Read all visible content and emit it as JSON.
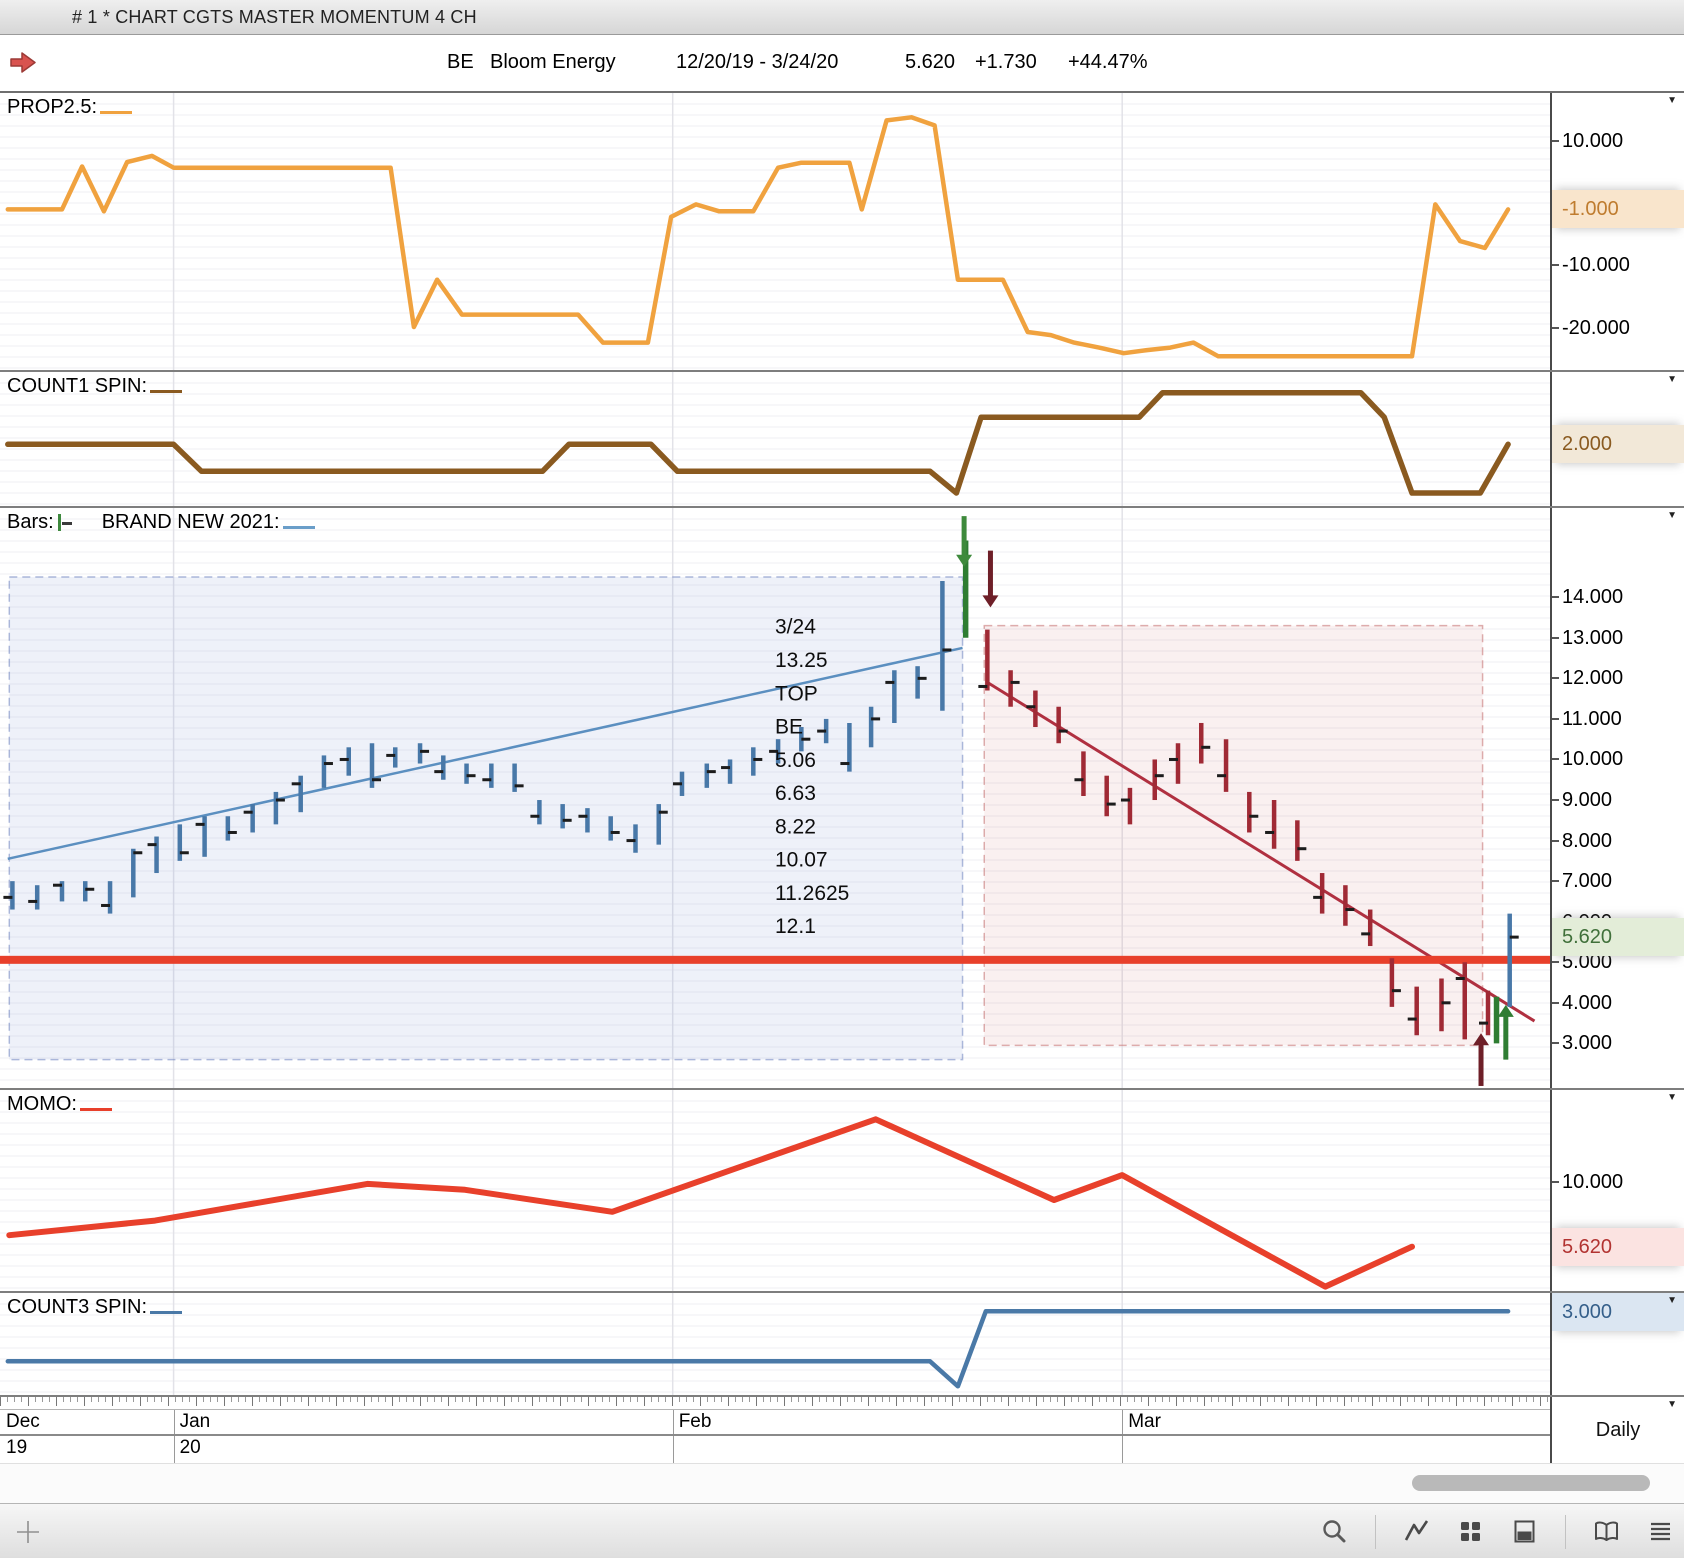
{
  "window": {
    "title": "# 1 * CHART CGTS MASTER MOMENTUM 4 CH"
  },
  "header": {
    "symbol": "BE",
    "name": "Bloom Energy",
    "range": "12/20/19 - 3/24/20",
    "last": "5.620",
    "change": "+1.730",
    "pct": "+44.47%",
    "arrow_icon": "red-right-arrow-icon",
    "arrow_color": "#d9534f"
  },
  "xaxis": {
    "months": [
      {
        "label": "Dec",
        "year": "19",
        "frac": 0.0
      },
      {
        "label": "Jan",
        "year": "20",
        "frac": 0.112
      },
      {
        "label": "Feb",
        "year": "",
        "frac": 0.434
      },
      {
        "label": "Mar",
        "year": "",
        "frac": 0.724
      }
    ],
    "period": "Daily"
  },
  "toolbar": {
    "left_icon": "crosshair-plus-icon",
    "right_icons": [
      "magnifier-icon",
      "line-chart-icon",
      "grid-view-icon",
      "split-view-icon",
      "book-icon",
      "menu-lines-icon"
    ]
  },
  "chart_data": [
    {
      "id": "prop25",
      "type": "line",
      "title": "PROP2.5:",
      "accent": "#f0a23f",
      "ylim": [
        -26.8,
        17.7
      ],
      "axis_labels": [
        {
          "v": 10,
          "label": "10.000"
        },
        {
          "v": -10,
          "label": "-10.000"
        },
        {
          "v": -20,
          "label": "-20.000"
        }
      ],
      "badge": {
        "v": -1,
        "label": "-1.000",
        "bg": "#f9e5cc",
        "fg": "#bf7c2f"
      },
      "series": [
        {
          "name": "PROP2.5",
          "color": "#f0a23f",
          "width": 4.5,
          "points": [
            [
              0.005,
              -1.0
            ],
            [
              0.04,
              -1.0
            ],
            [
              0.053,
              5.9
            ],
            [
              0.067,
              -1.3
            ],
            [
              0.082,
              6.6
            ],
            [
              0.098,
              7.6
            ],
            [
              0.112,
              5.7
            ],
            [
              0.252,
              5.7
            ],
            [
              0.267,
              -19.9
            ],
            [
              0.282,
              -12.3
            ],
            [
              0.298,
              -17.9
            ],
            [
              0.373,
              -17.9
            ],
            [
              0.389,
              -22.4
            ],
            [
              0.418,
              -22.4
            ],
            [
              0.433,
              -2.2
            ],
            [
              0.449,
              -0.2
            ],
            [
              0.464,
              -1.3
            ],
            [
              0.486,
              -1.3
            ],
            [
              0.502,
              5.7
            ],
            [
              0.517,
              6.5
            ],
            [
              0.548,
              6.5
            ],
            [
              0.556,
              -1.0
            ],
            [
              0.572,
              13.3
            ],
            [
              0.588,
              13.8
            ],
            [
              0.603,
              12.5
            ],
            [
              0.618,
              -12.3
            ],
            [
              0.647,
              -12.3
            ],
            [
              0.663,
              -20.7
            ],
            [
              0.678,
              -21.2
            ],
            [
              0.693,
              -22.4
            ],
            [
              0.709,
              -23.2
            ],
            [
              0.725,
              -24.1
            ],
            [
              0.74,
              -23.6
            ],
            [
              0.755,
              -23.2
            ],
            [
              0.77,
              -22.4
            ],
            [
              0.786,
              -24.6
            ],
            [
              0.911,
              -24.6
            ],
            [
              0.926,
              -0.2
            ],
            [
              0.942,
              -6.1
            ],
            [
              0.958,
              -7.2
            ],
            [
              0.973,
              -1.0
            ]
          ]
        }
      ]
    },
    {
      "id": "count1",
      "type": "line",
      "title": "COUNT1 SPIN:",
      "accent": "#8a5a20",
      "ylim": [
        -0.28,
        4.67
      ],
      "axis_labels": [],
      "badge": {
        "v": 2,
        "label": "2.000",
        "bg": "#f2e8d8",
        "fg": "#8a5a20"
      },
      "series": [
        {
          "name": "COUNT1 SPIN",
          "color": "#8a5a20",
          "width": 5.5,
          "points": [
            [
              0.005,
              2
            ],
            [
              0.112,
              2
            ],
            [
              0.13,
              1
            ],
            [
              0.35,
              1
            ],
            [
              0.367,
              2
            ],
            [
              0.42,
              2
            ],
            [
              0.437,
              1
            ],
            [
              0.6,
              1
            ],
            [
              0.617,
              0.2
            ],
            [
              0.633,
              3
            ],
            [
              0.735,
              3
            ],
            [
              0.75,
              3.9
            ],
            [
              0.878,
              3.9
            ],
            [
              0.893,
              3
            ],
            [
              0.911,
              0.2
            ],
            [
              0.955,
              0.2
            ],
            [
              0.973,
              2.0
            ]
          ]
        }
      ]
    },
    {
      "id": "bars",
      "type": "ohlc-bars",
      "title": "Bars:",
      "title2": "BRAND NEW 2021:",
      "accent": "#6a9ec9",
      "bar_glyph_color": "#3f8a3f",
      "ylim": [
        1.9,
        16.2
      ],
      "axis_labels": [
        {
          "v": 14,
          "label": "14.000"
        },
        {
          "v": 13,
          "label": "13.000"
        },
        {
          "v": 12,
          "label": "12.000"
        },
        {
          "v": 11,
          "label": "11.000"
        },
        {
          "v": 10,
          "label": "10.000"
        },
        {
          "v": 9,
          "label": "9.000"
        },
        {
          "v": 8,
          "label": "8.000"
        },
        {
          "v": 7,
          "label": "7.000"
        },
        {
          "v": 6,
          "label": "6.000"
        },
        {
          "v": 5,
          "label": "5.000"
        },
        {
          "v": 4,
          "label": "4.000"
        },
        {
          "v": 3,
          "label": "3.000"
        }
      ],
      "badge": {
        "v": 5.62,
        "label": "5.620",
        "bg": "#e3edd8",
        "fg": "#40703a"
      },
      "boxes": [
        {
          "x0": 0.006,
          "x1": 0.621,
          "v0": 2.6,
          "v1": 14.5,
          "fill": "rgba(125,145,205,0.13)",
          "stroke": "rgba(110,130,190,0.55)"
        },
        {
          "x0": 0.635,
          "x1": 0.9565,
          "v0": 2.95,
          "v1": 13.3,
          "fill": "rgba(205,110,110,0.10)",
          "stroke": "rgba(205,130,130,0.65)"
        }
      ],
      "trendlines": [
        {
          "name": "uptrend",
          "color": "#5b8fc0",
          "width": 2.5,
          "points": [
            [
              0.005,
              7.55
            ],
            [
              0.621,
              12.75
            ]
          ]
        },
        {
          "name": "downtrend",
          "color": "#b03040",
          "width": 3,
          "points": [
            [
              0.637,
              11.9
            ],
            [
              0.99,
              3.55
            ]
          ]
        }
      ],
      "hline": {
        "v": 5.06,
        "color": "#e8402b",
        "width": 8
      },
      "bars_up": {
        "color": "#4878a8",
        "items": [
          [
            0.008,
            6.3,
            7.0,
            6.6,
            "L"
          ],
          [
            0.024,
            6.3,
            6.9,
            6.5,
            "L"
          ],
          [
            0.04,
            6.5,
            7.0,
            6.9,
            "L"
          ],
          [
            0.055,
            6.5,
            7.0,
            6.8,
            "R"
          ],
          [
            0.071,
            6.2,
            7.0,
            6.4,
            "L"
          ],
          [
            0.086,
            6.6,
            7.8,
            7.7,
            "R"
          ],
          [
            0.101,
            7.2,
            8.1,
            7.9,
            "L"
          ],
          [
            0.116,
            7.5,
            8.4,
            7.7,
            "R"
          ],
          [
            0.132,
            7.6,
            8.6,
            8.4,
            "L"
          ],
          [
            0.147,
            8.0,
            8.6,
            8.2,
            "R"
          ],
          [
            0.163,
            8.2,
            8.9,
            8.7,
            "L"
          ],
          [
            0.178,
            8.4,
            9.2,
            9.0,
            "R"
          ],
          [
            0.194,
            8.7,
            9.6,
            9.4,
            "L"
          ],
          [
            0.209,
            9.3,
            10.1,
            9.9,
            "R"
          ],
          [
            0.225,
            9.6,
            10.3,
            10.0,
            "L"
          ],
          [
            0.24,
            9.3,
            10.4,
            9.5,
            "R"
          ],
          [
            0.255,
            9.8,
            10.3,
            10.1,
            "L"
          ],
          [
            0.271,
            9.9,
            10.4,
            10.2,
            "R"
          ],
          [
            0.286,
            9.5,
            10.1,
            9.7,
            "L"
          ],
          [
            0.301,
            9.4,
            9.9,
            9.6,
            "R"
          ],
          [
            0.317,
            9.3,
            9.9,
            9.5,
            "L"
          ],
          [
            0.332,
            9.2,
            9.9,
            9.35,
            "R"
          ],
          [
            0.348,
            8.4,
            9.0,
            8.6,
            "L"
          ],
          [
            0.363,
            8.3,
            8.9,
            8.5,
            "R"
          ],
          [
            0.379,
            8.2,
            8.8,
            8.6,
            "L"
          ],
          [
            0.394,
            8.0,
            8.6,
            8.2,
            "R"
          ],
          [
            0.41,
            7.7,
            8.4,
            8.0,
            "L"
          ],
          [
            0.425,
            7.9,
            8.9,
            8.7,
            "R"
          ],
          [
            0.44,
            9.1,
            9.7,
            9.4,
            "L"
          ],
          [
            0.456,
            9.3,
            9.9,
            9.7,
            "R"
          ],
          [
            0.471,
            9.4,
            10.0,
            9.8,
            "L"
          ],
          [
            0.486,
            9.6,
            10.3,
            10.0,
            "R"
          ],
          [
            0.502,
            9.9,
            10.5,
            10.2,
            "L"
          ],
          [
            0.517,
            10.2,
            10.8,
            10.5,
            "R"
          ],
          [
            0.533,
            10.4,
            11.0,
            10.7,
            "L"
          ],
          [
            0.548,
            9.7,
            10.9,
            9.9,
            "L"
          ],
          [
            0.562,
            10.3,
            11.3,
            11.0,
            "R"
          ],
          [
            0.577,
            10.9,
            12.2,
            11.9,
            "L"
          ],
          [
            0.592,
            11.5,
            12.3,
            12.0,
            "R"
          ],
          [
            0.608,
            11.2,
            14.4,
            12.7,
            "R"
          ],
          [
            0.974,
            3.9,
            6.2,
            5.62,
            "R"
          ]
        ]
      },
      "bars_down": {
        "color": "#a02a35",
        "items": [
          [
            0.637,
            11.7,
            13.2,
            11.8,
            "L"
          ],
          [
            0.652,
            11.3,
            12.2,
            11.9,
            "R"
          ],
          [
            0.668,
            10.8,
            11.7,
            11.3,
            "L"
          ],
          [
            0.683,
            10.4,
            11.3,
            10.7,
            "R"
          ],
          [
            0.699,
            9.1,
            10.2,
            9.5,
            "L"
          ],
          [
            0.714,
            8.6,
            9.6,
            8.9,
            "R"
          ],
          [
            0.729,
            8.4,
            9.3,
            9.0,
            "L"
          ],
          [
            0.745,
            9.0,
            10.0,
            9.6,
            "R"
          ],
          [
            0.76,
            9.4,
            10.4,
            10.0,
            "L"
          ],
          [
            0.775,
            9.9,
            10.9,
            10.3,
            "R"
          ],
          [
            0.791,
            9.2,
            10.5,
            9.6,
            "L"
          ],
          [
            0.806,
            8.2,
            9.2,
            8.6,
            "R"
          ],
          [
            0.822,
            7.8,
            9.0,
            8.2,
            "L"
          ],
          [
            0.837,
            7.5,
            8.5,
            7.8,
            "R"
          ],
          [
            0.853,
            6.2,
            7.2,
            6.6,
            "L"
          ],
          [
            0.868,
            5.9,
            6.9,
            6.3,
            "R"
          ],
          [
            0.884,
            5.4,
            6.3,
            5.7,
            "L"
          ],
          [
            0.898,
            3.9,
            5.1,
            4.3,
            "R"
          ],
          [
            0.914,
            3.2,
            4.4,
            3.6,
            "L"
          ],
          [
            0.93,
            3.3,
            4.6,
            4.0,
            "R"
          ],
          [
            0.945,
            3.1,
            5.0,
            4.6,
            "L"
          ],
          [
            0.96,
            3.2,
            4.3,
            3.5,
            "L"
          ]
        ]
      },
      "extra_bars": [
        {
          "name": "green-signal-bar-top",
          "color": "#2e7d32",
          "x": 0.623,
          "v0": 13.0,
          "v1": 15.4
        },
        {
          "name": "green-signal-bar-bottom",
          "color": "#2e7d32",
          "x": 0.9655,
          "v0": 3.0,
          "v1": 4.15
        }
      ],
      "arrows": [
        {
          "name": "green-down-arrow",
          "x": 0.622,
          "dir": "down",
          "v_tip": 14.75,
          "v_tail": 16.0,
          "color": "#3e8a3c"
        },
        {
          "name": "darkred-down-arrow",
          "x": 0.639,
          "dir": "down",
          "v_tip": 13.75,
          "v_tail": 15.15,
          "color": "#6e1f28"
        },
        {
          "name": "darkred-up-arrow",
          "x": 0.9555,
          "dir": "up",
          "v_tip": 3.25,
          "v_tail": 1.95,
          "color": "#6e1f28"
        },
        {
          "name": "green-up-arrow",
          "x": 0.9715,
          "dir": "up",
          "v_tip": 3.95,
          "v_tail": 2.6,
          "color": "#2f7d33"
        }
      ],
      "annotation": {
        "x": 0.5,
        "v_top": 13.1,
        "line_step": 0.82,
        "lines": [
          "3/24",
          "13.25",
          "TOP",
          "BE",
          "5.06",
          "6.63",
          "8.22",
          "10.07",
          "11.2625",
          "12.1"
        ]
      }
    },
    {
      "id": "momo",
      "type": "line",
      "title": "MOMO:",
      "accent": "#e8402b",
      "ylim": [
        2.6,
        16.3
      ],
      "axis_labels": [
        {
          "v": 10,
          "label": "10.000"
        }
      ],
      "badge": {
        "v": 5.62,
        "label": "5.620",
        "bg": "#fbe3e1",
        "fg": "#b23331"
      },
      "series": [
        {
          "name": "MOMO",
          "color": "#e8402b",
          "width": 6,
          "points": [
            [
              0.006,
              6.4
            ],
            [
              0.1,
              7.4
            ],
            [
              0.237,
              9.9
            ],
            [
              0.3,
              9.5
            ],
            [
              0.395,
              8.0
            ],
            [
              0.565,
              14.3
            ],
            [
              0.68,
              8.8
            ],
            [
              0.724,
              10.5
            ],
            [
              0.855,
              2.9
            ],
            [
              0.911,
              5.62
            ]
          ]
        }
      ]
    },
    {
      "id": "count3",
      "type": "line",
      "title": "COUNT3 SPIN:",
      "accent": "#4a79a7",
      "ylim": [
        -0.35,
        3.73
      ],
      "axis_labels": [],
      "badge": {
        "v": 3,
        "label": "3.000",
        "bg": "#dbe6f2",
        "fg": "#355f8a"
      },
      "series": [
        {
          "name": "COUNT3 SPIN",
          "color": "#4a79a7",
          "width": 4.5,
          "points": [
            [
              0.005,
              1
            ],
            [
              0.6,
              1
            ],
            [
              0.618,
              0
            ],
            [
              0.636,
              3
            ],
            [
              0.973,
              3
            ]
          ]
        }
      ]
    }
  ]
}
